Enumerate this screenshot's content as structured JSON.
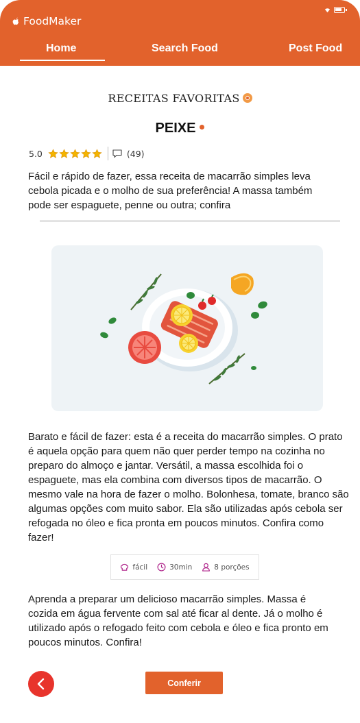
{
  "app": {
    "name": "FoodMaker"
  },
  "nav": {
    "tabs": [
      {
        "label": "Home",
        "active": true
      },
      {
        "label": "Search Food",
        "active": false
      },
      {
        "label": "Post Food",
        "active": false
      }
    ]
  },
  "section": {
    "title": "RECEITAS FAVORITAS",
    "icon": "favorite-badge-icon"
  },
  "recipe": {
    "title": "PEIXE",
    "rating": "5.0",
    "stars": 5,
    "comment_count": "(49)",
    "intro": "Fácil e rápido de fazer, essa receita de macarrão simples leva cebola picada e o molho de sua preferência! A massa também pode ser espaguete, penne ou outra; confira",
    "body": "Barato e fácil de fazer: esta é a receita do macarrão simples. O prato é aquela opção para quem não quer perder tempo na cozinha no preparo do almoço e jantar. Versátil, a massa escolhida foi o espaguete, mas ela combina com diversos tipos de macarrão. O mesmo vale na hora de fazer o molho. Bolonhesa, tomate, branco são algumas opções com muito sabor. Ela são utilizadas após cebola ser refogada no óleo e fica pronta em poucos minutos. Confira como fazer!",
    "info": {
      "difficulty": "fácil",
      "time": "30min",
      "servings": "8 porções"
    },
    "outro": "Aprenda a preparar um delicioso macarrão simples. Massa é cozida em água fervente com sal até ficar al dente. Já o molho é utilizado após o refogado feito com cebola e óleo e fica pronto em poucos minutos. Confira!"
  },
  "actions": {
    "confirm_label": "Conferir"
  },
  "colors": {
    "brand": "#e2622c",
    "back_button": "#e8342c",
    "star": "#f4b400",
    "info_icon": "#b0278c"
  }
}
